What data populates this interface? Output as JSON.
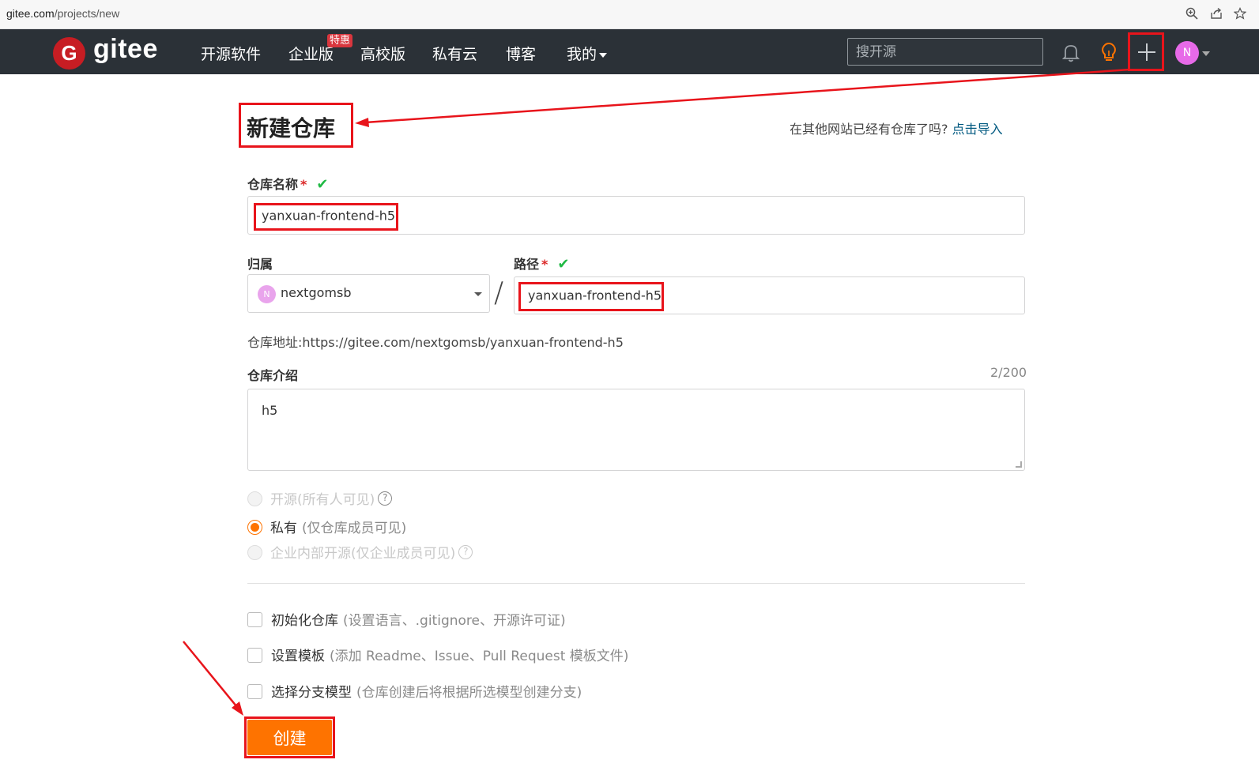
{
  "browser": {
    "url_domain": "gitee.com",
    "url_path": "/projects/new"
  },
  "nav": {
    "logo_text": "gitee",
    "items": [
      "开源软件",
      "企业版",
      "高校版",
      "私有云",
      "博客",
      "我的"
    ],
    "hot_badge": "特惠",
    "search_placeholder": "搜开源",
    "avatar_initial": "N"
  },
  "page": {
    "title": "新建仓库",
    "import_tip": "在其他网站已经有仓库了吗?",
    "import_link": "点击导入"
  },
  "form": {
    "name_label": "仓库名称",
    "name_value": "yanxuan-frontend-h5",
    "owner_label": "归属",
    "owner_avatar": "N",
    "owner_value": "nextgomsb",
    "path_label": "路径",
    "path_value": "yanxuan-frontend-h5",
    "required_mark": "*",
    "check_mark": "✔",
    "repo_url_label": "仓库地址:",
    "repo_url_value": "https://gitee.com/nextgomsb/yanxuan-frontend-h5",
    "desc_label": "仓库介绍",
    "desc_counter": "2/200",
    "desc_value": "h5",
    "visibility": [
      {
        "label": "开源",
        "hint": "(所有人可见)",
        "selected": false,
        "disabled": true
      },
      {
        "label": "私有",
        "hint": "(仅仓库成员可见)",
        "selected": true,
        "disabled": false
      },
      {
        "label": "企业内部开源",
        "hint": "(仅企业成员可见)",
        "selected": false,
        "disabled": true
      }
    ],
    "options": [
      {
        "label": "初始化仓库",
        "hint": "(设置语言、.gitignore、开源许可证)"
      },
      {
        "label": "设置模板",
        "hint": "(添加 Readme、Issue、Pull Request 模板文件)"
      },
      {
        "label": "选择分支模型",
        "hint": "(仓库创建后将根据所选模型创建分支)"
      }
    ],
    "submit_label": "创建"
  },
  "colors": {
    "nav_bg": "#2b3137",
    "accent": "#fe7300",
    "annotation": "#e8141b",
    "link": "#005980"
  }
}
